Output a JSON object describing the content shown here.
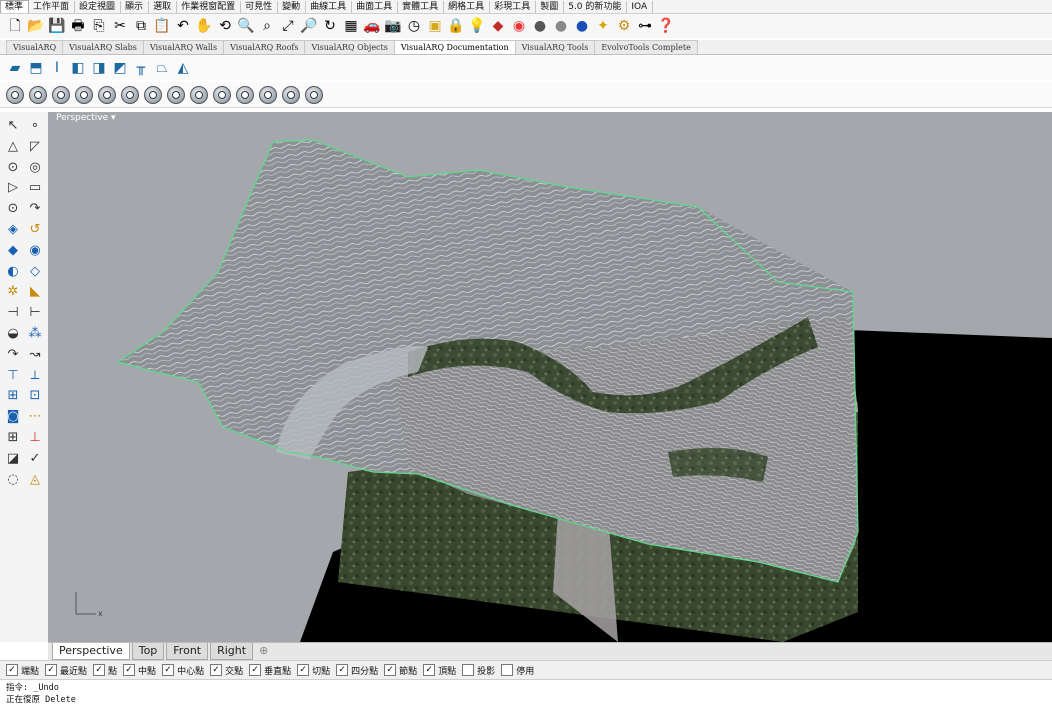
{
  "menu": {
    "items": [
      "標準",
      "工作平面",
      "設定視圖",
      "顯示",
      "選取",
      "作業視窗配置",
      "可見性",
      "變動",
      "曲線工具",
      "曲面工具",
      "實體工具",
      "網格工具",
      "彩現工具",
      "製圖",
      "5.0 的新功能",
      "IOA"
    ]
  },
  "toolbar_main": {
    "icons": [
      "new-file-icon",
      "open-folder-icon",
      "save-icon",
      "print-icon",
      "import-icon",
      "cut-icon",
      "copy-icon",
      "paste-icon",
      "undo-icon",
      "pan-hand-icon",
      "rotate-view-icon",
      "zoom-icon",
      "zoom-window-icon",
      "zoom-extents-icon",
      "zoom-selected-icon",
      "rotate-3d-icon",
      "grid-icon",
      "car-icon",
      "camera-icon",
      "clock-icon",
      "layer-icon",
      "lock-icon",
      "lightbulb-icon",
      "material-icon",
      "color-wheel-icon",
      "sphere-shaded-icon",
      "sphere-rendered-icon",
      "blue-sphere-icon",
      "flashlight-icon",
      "gears-icon",
      "options-icon",
      "help-icon"
    ]
  },
  "plugin_tabs": {
    "active_index": 5,
    "tabs": [
      "VisualARQ",
      "VisualARQ Slabs",
      "VisualARQ Walls",
      "VisualARQ Roofs",
      "VisualARQ Objects",
      "VisualARQ Documentation",
      "VisualARQ Tools",
      "EvolvoTools Complete"
    ]
  },
  "toolbar_visualarq": {
    "icons": [
      "wall-icon",
      "slab-icon",
      "column-icon",
      "door-icon",
      "window-icon",
      "stair-icon",
      "railing-icon",
      "roof-icon",
      "beam-icon"
    ]
  },
  "toolbar_evolvo": {
    "count": 14
  },
  "viewport": {
    "title": "Perspective",
    "title_arrow": "▾",
    "axis_x": "x",
    "colors": {
      "background": "#a4a8ad",
      "terrain": "#8f9296",
      "boundary": "#5fd98a",
      "shadow": "#000000"
    }
  },
  "view_tabs": {
    "active_index": 0,
    "tabs": [
      "Perspective",
      "Top",
      "Front",
      "Right"
    ],
    "add_label": "⊕"
  },
  "osnap": [
    {
      "label": "端點",
      "checked": true
    },
    {
      "label": "最近點",
      "checked": true
    },
    {
      "label": "點",
      "checked": true
    },
    {
      "label": "中點",
      "checked": true
    },
    {
      "label": "中心點",
      "checked": true
    },
    {
      "label": "交點",
      "checked": true
    },
    {
      "label": "垂直點",
      "checked": true
    },
    {
      "label": "切點",
      "checked": true
    },
    {
      "label": "四分點",
      "checked": true
    },
    {
      "label": "節點",
      "checked": true
    },
    {
      "label": "頂點",
      "checked": true
    },
    {
      "label": "投影",
      "checked": false
    },
    {
      "label": "停用",
      "checked": false
    }
  ],
  "command": {
    "line1": "指令: _Undo",
    "line2": "正在復原 Delete"
  }
}
